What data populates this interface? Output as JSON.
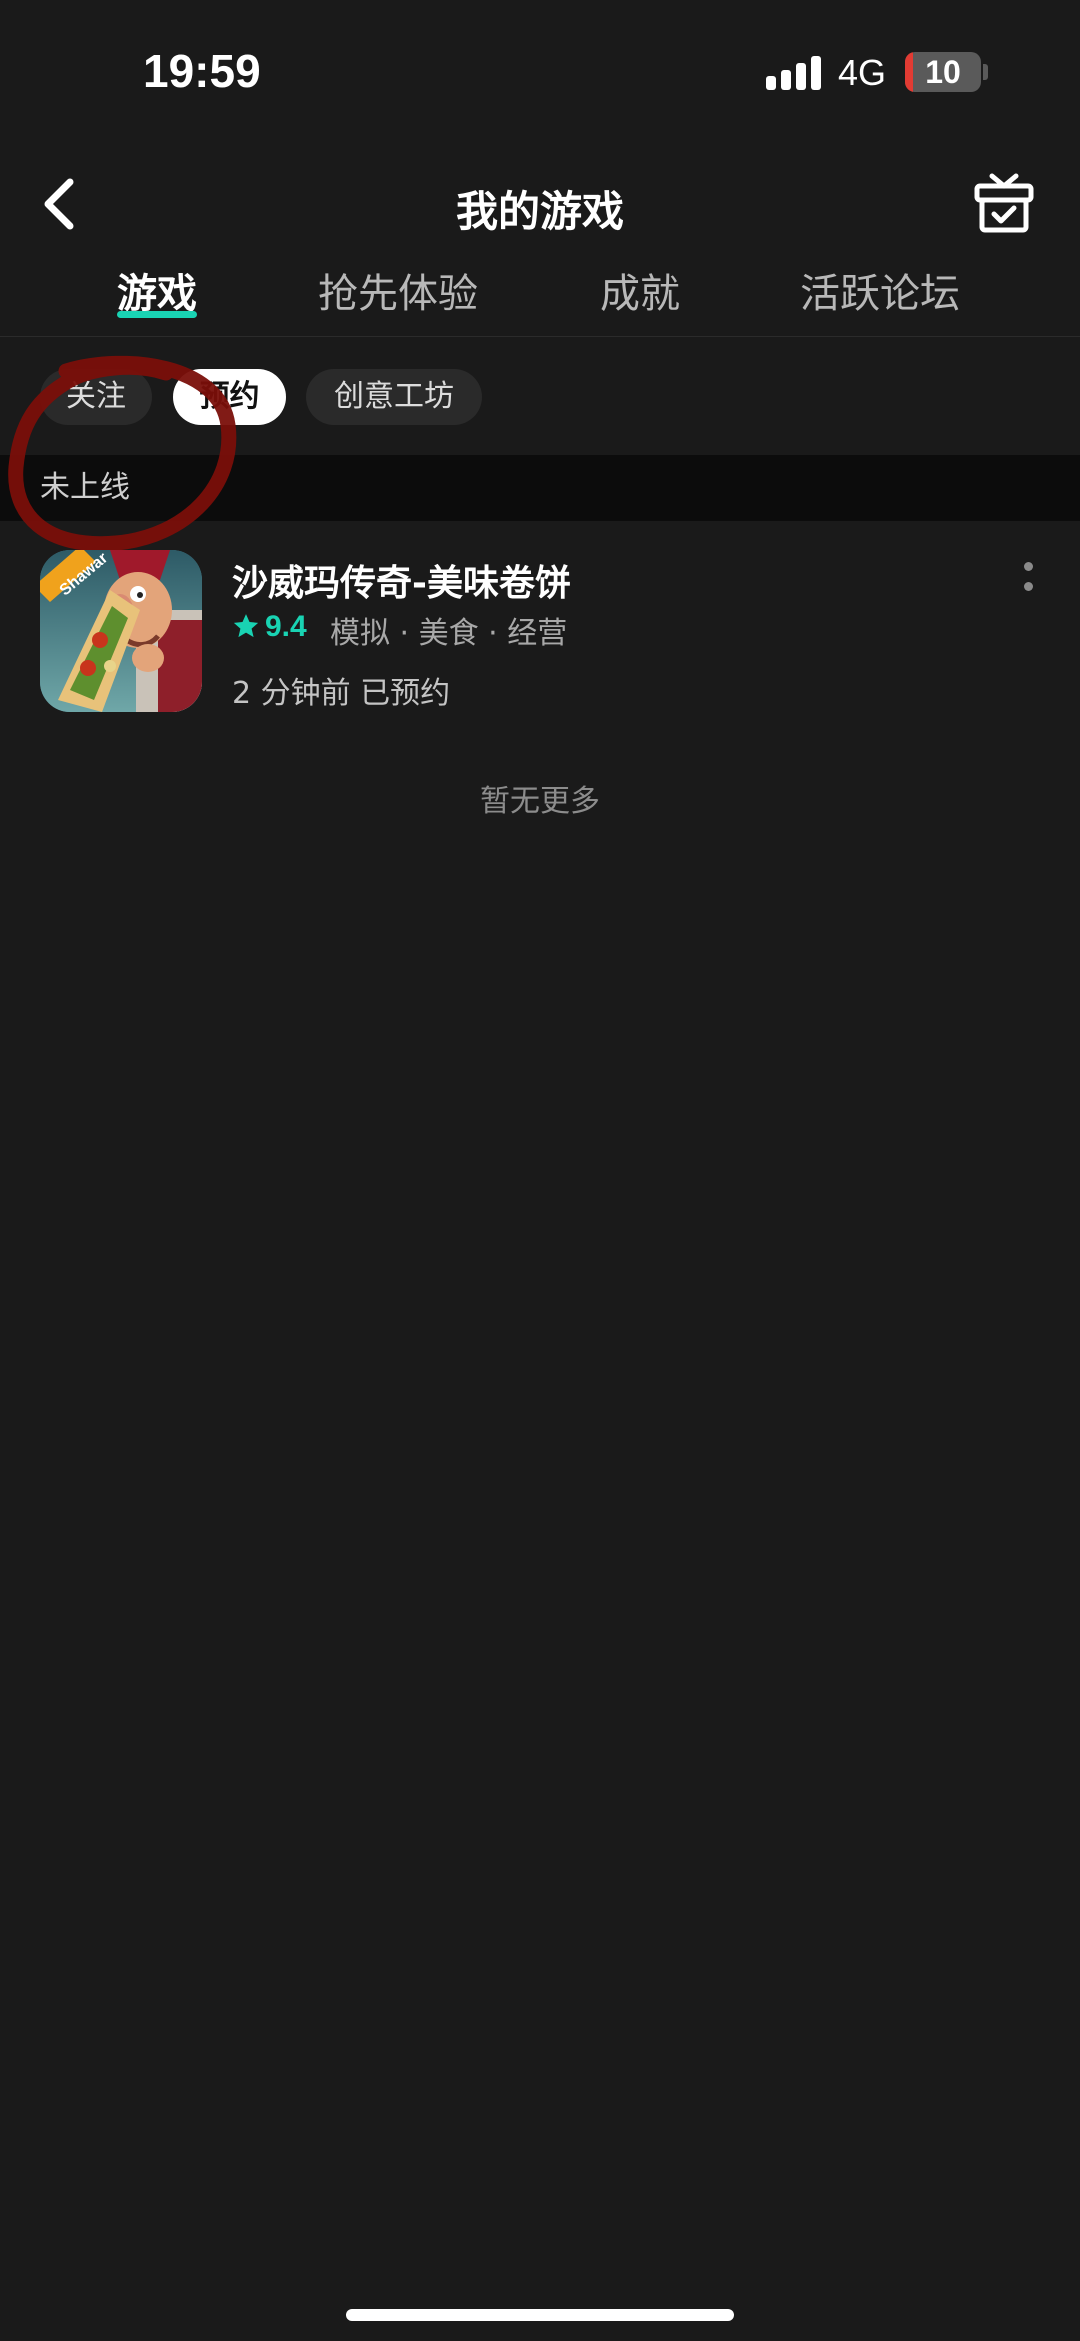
{
  "status_bar": {
    "time": "19:59",
    "network": "4G",
    "battery": "10",
    "battery_level": 0.1
  },
  "nav": {
    "back_icon": "chevron-left-icon",
    "title": "我的游戏",
    "gift_icon": "gift-box-icon"
  },
  "tabs": [
    {
      "label": "游戏",
      "active": true
    },
    {
      "label": "抢先体验",
      "active": false
    },
    {
      "label": "成就",
      "active": false
    },
    {
      "label": "活跃论坛",
      "active": false
    }
  ],
  "filter_chips": [
    {
      "label": "关注",
      "active": false
    },
    {
      "label": "预约",
      "active": true
    },
    {
      "label": "创意工坊",
      "active": false
    }
  ],
  "section": {
    "title": "未上线"
  },
  "games": [
    {
      "title": "沙威玛传奇-美味卷饼",
      "rating": "9.4",
      "tags": "模拟 · 美食 · 经营",
      "status": "2 分钟前 已预约",
      "icon_text": "Shawar"
    }
  ],
  "footer": {
    "no_more": "暂无更多"
  },
  "colors": {
    "background": "#1a1a1a",
    "accent": "#19d3b3",
    "annotation": "#7a0f0a"
  }
}
